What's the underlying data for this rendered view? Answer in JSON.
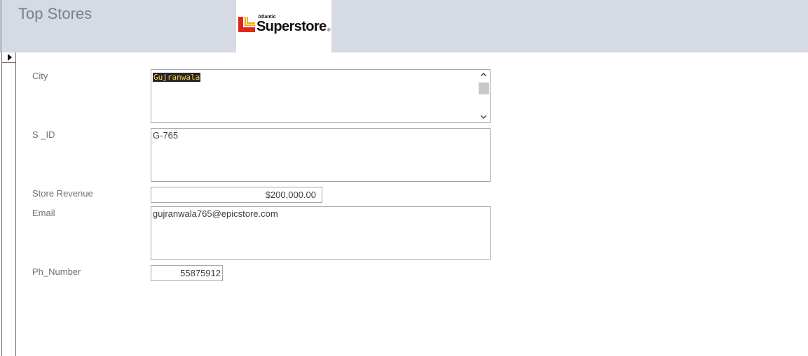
{
  "header": {
    "title": "Top Stores",
    "logo": {
      "small_text": "Atlantic",
      "brand_text": "Superstore",
      "mark_color": "#e1251b",
      "accent_color": "#f2a900"
    }
  },
  "form": {
    "fields": {
      "city": {
        "label": "City",
        "value": "Gujranwala"
      },
      "s_id": {
        "label": "S _ID",
        "value": "G-765"
      },
      "store_revenue": {
        "label": "Store Revenue",
        "value": "$200,000.00"
      },
      "email": {
        "label": "Email",
        "value": "gujranwala765@epicstore.com"
      },
      "ph_number": {
        "label": "Ph_Number",
        "value": "55875912"
      }
    }
  },
  "colors": {
    "header_bg": "#d5dae4",
    "label_text": "#6d7178",
    "field_border": "#a6a6a6",
    "selection_bg": "#262626",
    "selection_text": "#ffd34a"
  },
  "icons": {
    "record_selector": "triangle-right",
    "scroll_up": "chevron-up",
    "scroll_down": "chevron-down"
  }
}
